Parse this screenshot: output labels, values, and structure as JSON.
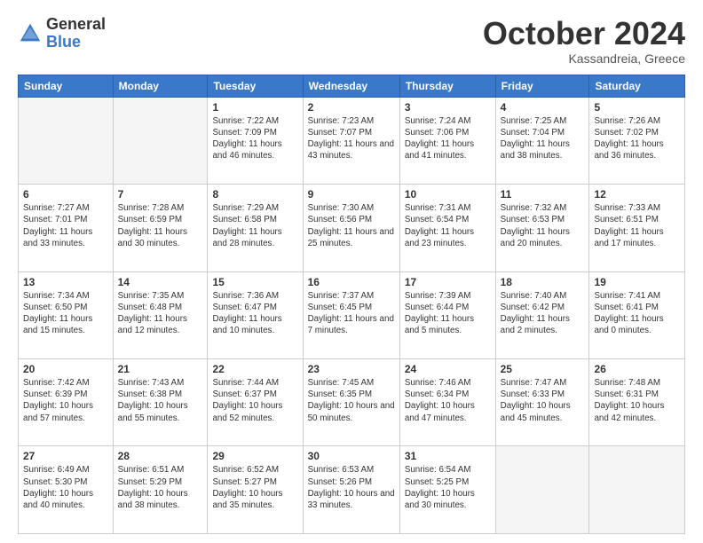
{
  "header": {
    "logo_general": "General",
    "logo_blue": "Blue",
    "month_title": "October 2024",
    "location": "Kassandreia, Greece"
  },
  "days_of_week": [
    "Sunday",
    "Monday",
    "Tuesday",
    "Wednesday",
    "Thursday",
    "Friday",
    "Saturday"
  ],
  "weeks": [
    [
      {
        "day": "",
        "empty": true
      },
      {
        "day": "",
        "empty": true
      },
      {
        "day": "1",
        "sunrise": "7:22 AM",
        "sunset": "7:09 PM",
        "daylight": "11 hours and 46 minutes."
      },
      {
        "day": "2",
        "sunrise": "7:23 AM",
        "sunset": "7:07 PM",
        "daylight": "11 hours and 43 minutes."
      },
      {
        "day": "3",
        "sunrise": "7:24 AM",
        "sunset": "7:06 PM",
        "daylight": "11 hours and 41 minutes."
      },
      {
        "day": "4",
        "sunrise": "7:25 AM",
        "sunset": "7:04 PM",
        "daylight": "11 hours and 38 minutes."
      },
      {
        "day": "5",
        "sunrise": "7:26 AM",
        "sunset": "7:02 PM",
        "daylight": "11 hours and 36 minutes."
      }
    ],
    [
      {
        "day": "6",
        "sunrise": "7:27 AM",
        "sunset": "7:01 PM",
        "daylight": "11 hours and 33 minutes."
      },
      {
        "day": "7",
        "sunrise": "7:28 AM",
        "sunset": "6:59 PM",
        "daylight": "11 hours and 30 minutes."
      },
      {
        "day": "8",
        "sunrise": "7:29 AM",
        "sunset": "6:58 PM",
        "daylight": "11 hours and 28 minutes."
      },
      {
        "day": "9",
        "sunrise": "7:30 AM",
        "sunset": "6:56 PM",
        "daylight": "11 hours and 25 minutes."
      },
      {
        "day": "10",
        "sunrise": "7:31 AM",
        "sunset": "6:54 PM",
        "daylight": "11 hours and 23 minutes."
      },
      {
        "day": "11",
        "sunrise": "7:32 AM",
        "sunset": "6:53 PM",
        "daylight": "11 hours and 20 minutes."
      },
      {
        "day": "12",
        "sunrise": "7:33 AM",
        "sunset": "6:51 PM",
        "daylight": "11 hours and 17 minutes."
      }
    ],
    [
      {
        "day": "13",
        "sunrise": "7:34 AM",
        "sunset": "6:50 PM",
        "daylight": "11 hours and 15 minutes."
      },
      {
        "day": "14",
        "sunrise": "7:35 AM",
        "sunset": "6:48 PM",
        "daylight": "11 hours and 12 minutes."
      },
      {
        "day": "15",
        "sunrise": "7:36 AM",
        "sunset": "6:47 PM",
        "daylight": "11 hours and 10 minutes."
      },
      {
        "day": "16",
        "sunrise": "7:37 AM",
        "sunset": "6:45 PM",
        "daylight": "11 hours and 7 minutes."
      },
      {
        "day": "17",
        "sunrise": "7:39 AM",
        "sunset": "6:44 PM",
        "daylight": "11 hours and 5 minutes."
      },
      {
        "day": "18",
        "sunrise": "7:40 AM",
        "sunset": "6:42 PM",
        "daylight": "11 hours and 2 minutes."
      },
      {
        "day": "19",
        "sunrise": "7:41 AM",
        "sunset": "6:41 PM",
        "daylight": "11 hours and 0 minutes."
      }
    ],
    [
      {
        "day": "20",
        "sunrise": "7:42 AM",
        "sunset": "6:39 PM",
        "daylight": "10 hours and 57 minutes."
      },
      {
        "day": "21",
        "sunrise": "7:43 AM",
        "sunset": "6:38 PM",
        "daylight": "10 hours and 55 minutes."
      },
      {
        "day": "22",
        "sunrise": "7:44 AM",
        "sunset": "6:37 PM",
        "daylight": "10 hours and 52 minutes."
      },
      {
        "day": "23",
        "sunrise": "7:45 AM",
        "sunset": "6:35 PM",
        "daylight": "10 hours and 50 minutes."
      },
      {
        "day": "24",
        "sunrise": "7:46 AM",
        "sunset": "6:34 PM",
        "daylight": "10 hours and 47 minutes."
      },
      {
        "day": "25",
        "sunrise": "7:47 AM",
        "sunset": "6:33 PM",
        "daylight": "10 hours and 45 minutes."
      },
      {
        "day": "26",
        "sunrise": "7:48 AM",
        "sunset": "6:31 PM",
        "daylight": "10 hours and 42 minutes."
      }
    ],
    [
      {
        "day": "27",
        "sunrise": "6:49 AM",
        "sunset": "5:30 PM",
        "daylight": "10 hours and 40 minutes."
      },
      {
        "day": "28",
        "sunrise": "6:51 AM",
        "sunset": "5:29 PM",
        "daylight": "10 hours and 38 minutes."
      },
      {
        "day": "29",
        "sunrise": "6:52 AM",
        "sunset": "5:27 PM",
        "daylight": "10 hours and 35 minutes."
      },
      {
        "day": "30",
        "sunrise": "6:53 AM",
        "sunset": "5:26 PM",
        "daylight": "10 hours and 33 minutes."
      },
      {
        "day": "31",
        "sunrise": "6:54 AM",
        "sunset": "5:25 PM",
        "daylight": "10 hours and 30 minutes."
      },
      {
        "day": "",
        "empty": true
      },
      {
        "day": "",
        "empty": true
      }
    ]
  ]
}
